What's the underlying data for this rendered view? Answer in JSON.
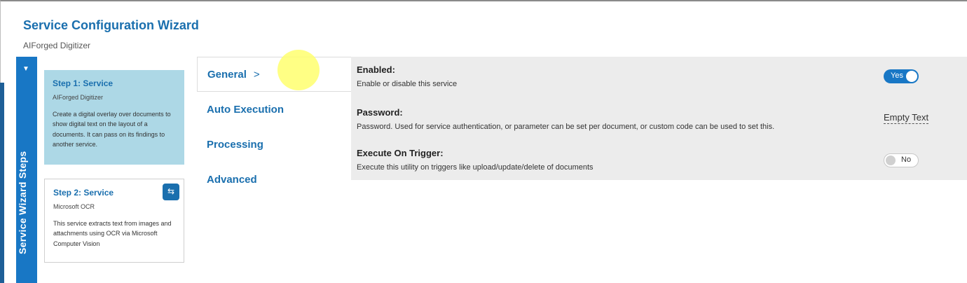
{
  "header": {
    "title": "Service Configuration Wizard",
    "subtitle": "AIForged Digitizer"
  },
  "steps_bar": {
    "label": "Service Wizard Steps"
  },
  "steps": [
    {
      "title": "Step 1: Service",
      "service": "AIForged Digitizer",
      "description": "Create a digital overlay over documents to show digital text on the layout of a documents. It can pass on its findings to another service.",
      "selected": true
    },
    {
      "title": "Step 2: Service",
      "service": "Microsoft OCR",
      "description": "This service extracts text from images and attachments using OCR via Microsoft Computer Vision",
      "selected": false
    }
  ],
  "tabs": [
    {
      "label": "General",
      "active": true
    },
    {
      "label": "Auto Execution",
      "active": false
    },
    {
      "label": "Processing",
      "active": false
    },
    {
      "label": "Advanced",
      "active": false
    }
  ],
  "settings": {
    "enabled": {
      "name": "Enabled:",
      "description": "Enable or disable this service",
      "value": "Yes"
    },
    "password": {
      "name": "Password:",
      "description": "Password. Used for service authentication, or parameter can be set per document, or custom code can be used to set this.",
      "value": "Empty Text"
    },
    "execute_on_trigger": {
      "name": "Execute On Trigger:",
      "description": "Execute this utility on triggers like upload/update/delete of documents",
      "value": "No"
    }
  },
  "icons": {
    "pin": "pin-icon",
    "swap": "swap-icon",
    "chevron": "chevron-right-icon"
  },
  "colors": {
    "accent": "#1877c5",
    "title": "#1a6fae",
    "selected_step": "#add8e6",
    "panel_bg": "#ececec"
  }
}
